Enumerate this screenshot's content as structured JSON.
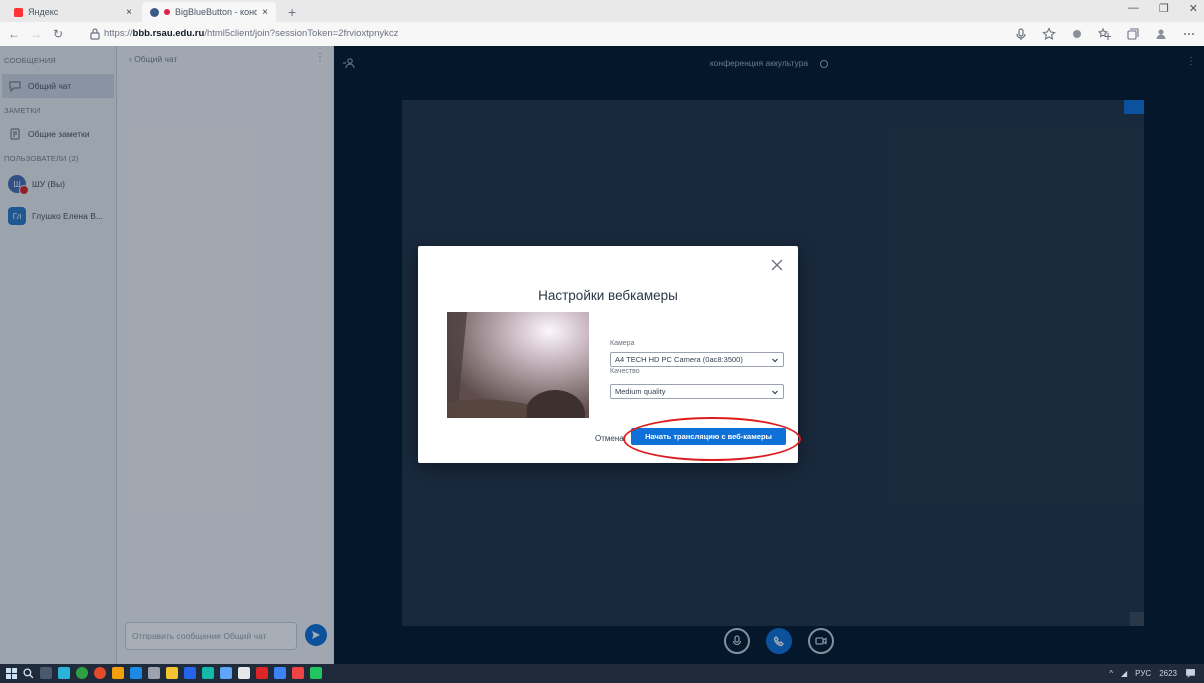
{
  "browser": {
    "tabs": [
      {
        "label": "Яндекс",
        "favicon_color": "#ff3333"
      },
      {
        "label": "BigBlueButton - конферен",
        "favicon_color": "#3b5a8a"
      }
    ],
    "url_prefix": "https://",
    "url_host": "bbb.rsau.edu.ru",
    "url_path": "/html5client/join?sessionToken=2frvioxtpnykcz"
  },
  "sidebar": {
    "messages_heading": "СООБЩЕНИЯ",
    "public_chat": "Общий чат",
    "notes_heading": "ЗАМЕТКИ",
    "shared_notes": "Общие заметки",
    "users_heading": "ПОЛЬЗОВАТЕЛИ (2)",
    "users": [
      {
        "initials": "Ш",
        "name": "ШУ (Вы)",
        "color": "#4a6fb5",
        "shape": "circle"
      },
      {
        "initials": "Гл",
        "name": "Глушко Елена В...",
        "color": "#2f79c8",
        "shape": "square"
      }
    ]
  },
  "chat": {
    "header": "‹ Общий чат",
    "input_placeholder": "Отправить сообщение Общий чат"
  },
  "meeting": {
    "title": "конференция аккультура"
  },
  "modal": {
    "title": "Настройки вебкамеры",
    "camera_label": "Камера",
    "camera_value": "A4 TECH HD PC Camera (0ac8:3500)",
    "quality_label": "Качество",
    "quality_value": "Medium quality",
    "cancel_label": "Отмена",
    "start_label": "Начать трансляцию с веб-камеры",
    "highlight_color": "#dc1e1e"
  },
  "taskbar": {
    "lang": "РУС",
    "time": "2623"
  },
  "colors": {
    "accent": "#0f70d7",
    "main_bg": "#06172a"
  }
}
